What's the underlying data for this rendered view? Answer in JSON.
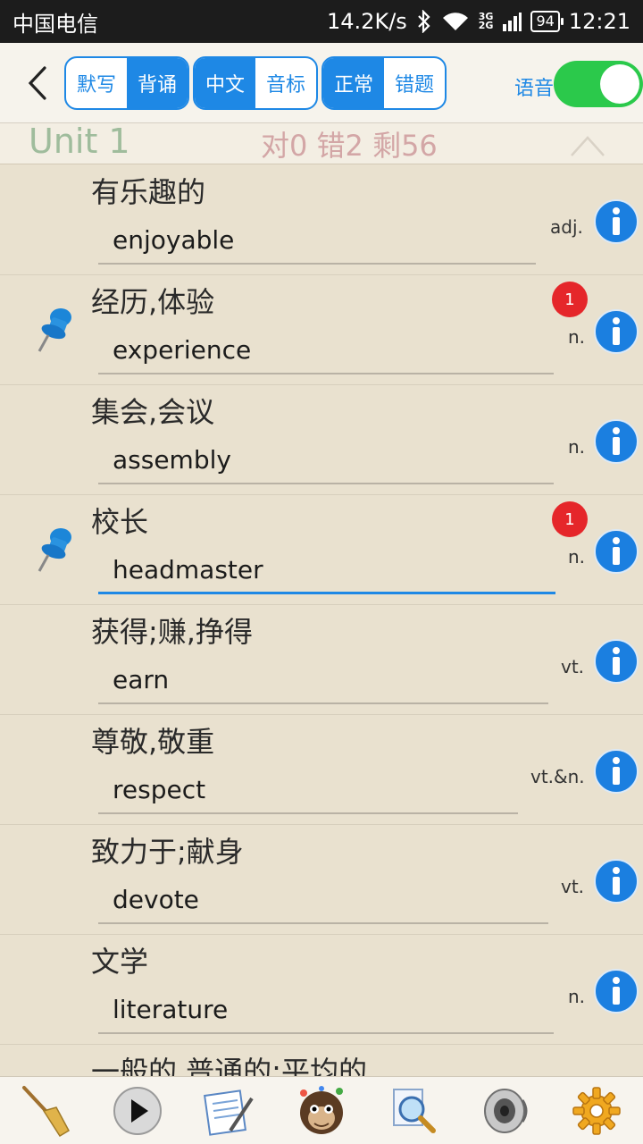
{
  "status_bar": {
    "carrier": "中国电信",
    "speed": "14.2K/s",
    "net_top": "3G",
    "net_bottom": "2G",
    "battery": "94",
    "time": "12:21"
  },
  "toolbar": {
    "seg1": [
      "默写",
      "背诵"
    ],
    "seg2": [
      "中文",
      "音标"
    ],
    "seg3": [
      "正常",
      "错题"
    ],
    "voice_label": "语音",
    "voice_on": true
  },
  "unit": {
    "title": "Unit 1",
    "stats": "对0 错2 剩56"
  },
  "words": [
    {
      "cn": "有乐趣的",
      "en": "enjoyable",
      "pos": "adj.",
      "pinned": false,
      "badge": ""
    },
    {
      "cn": "经历,体验",
      "en": "experience",
      "pos": "n.",
      "pinned": true,
      "badge": "1"
    },
    {
      "cn": "集会,会议",
      "en": "assembly",
      "pos": "n.",
      "pinned": false,
      "badge": ""
    },
    {
      "cn": "校长",
      "en": "headmaster",
      "pos": "n.",
      "pinned": true,
      "badge": "1"
    },
    {
      "cn": "获得;赚,挣得",
      "en": "earn",
      "pos": "vt.",
      "pinned": false,
      "badge": ""
    },
    {
      "cn": "尊敬,敬重",
      "en": "respect",
      "pos": "vt.&n.",
      "pinned": false,
      "badge": ""
    },
    {
      "cn": "致力于;献身",
      "en": "devote",
      "pos": "vt.",
      "pinned": false,
      "badge": ""
    },
    {
      "cn": "文学",
      "en": "literature",
      "pos": "n.",
      "pinned": false,
      "badge": ""
    },
    {
      "cn": "一般的,普通的;平均的",
      "en": "",
      "pos": "",
      "pinned": false,
      "badge": ""
    }
  ],
  "bottom_icons": [
    "broom-icon",
    "play-icon",
    "notepad-icon",
    "monkey-icon",
    "magnifier-icon",
    "speaker-icon",
    "gear-icon"
  ],
  "colors": {
    "accent": "#1e88e5",
    "toggle_on": "#2bc94b",
    "badge": "#e5262a",
    "unit_title": "#9fbc9c",
    "unit_stats": "#d3a6a6"
  }
}
